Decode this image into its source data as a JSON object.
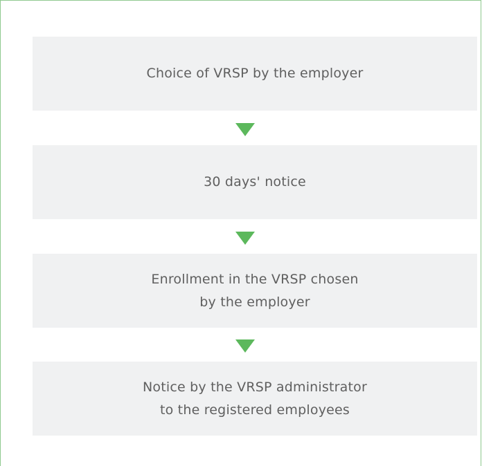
{
  "flow": {
    "steps": [
      {
        "lines": [
          "Choice of VRSP by the employer"
        ]
      },
      {
        "lines": [
          "30 days' notice"
        ]
      },
      {
        "lines": [
          "Enrollment in the VRSP chosen",
          "by the employer"
        ]
      },
      {
        "lines": [
          "Notice by the VRSP administrator",
          "to the registered employees"
        ]
      }
    ]
  },
  "colors": {
    "box_background": "#f0f1f2",
    "arrow": "#5cb85c",
    "border": "#8fc98f",
    "text": "#5f5f5f"
  },
  "icons": [
    "arrow-down-icon",
    "arrow-down-icon",
    "arrow-down-icon"
  ]
}
